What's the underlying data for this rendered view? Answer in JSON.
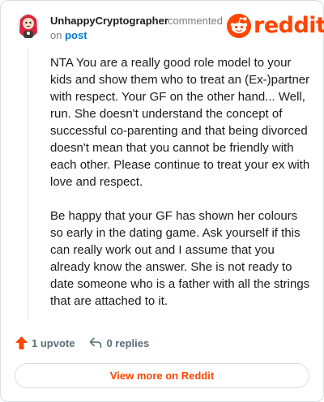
{
  "comment": {
    "username": "UnhappyCryptographer",
    "action_text": "commented",
    "on_text": "on",
    "post_link": "post",
    "paragraphs": [
      "NTA You are a really good role model to your kids and show them who to treat an (Ex-)partner with respect. Your GF on the other hand... Well, run. She doesn't understand the concept of successful co-parenting and that being divorced doesn't mean that you cannot be friendly with each other. Please continue to treat your ex with love and respect.",
      "Be happy that your GF has shown her colours so early in the dating game. Ask yourself if this can really work out and I assume that you already know the answer. She is not ready to date someone who is a father with all the strings that are attached to it."
    ],
    "upvotes": "1 upvote",
    "replies": "0 replies"
  },
  "brand": {
    "wordmark": "reddit",
    "accent_color": "#ff4500",
    "link_color": "#0079d3"
  },
  "footer": {
    "view_more_label": "View more on Reddit"
  },
  "icons": {
    "avatar": "avatar-icon",
    "logo": "reddit-snoo-icon",
    "upvote": "upvote-arrow-icon",
    "reply": "reply-arrow-icon"
  }
}
